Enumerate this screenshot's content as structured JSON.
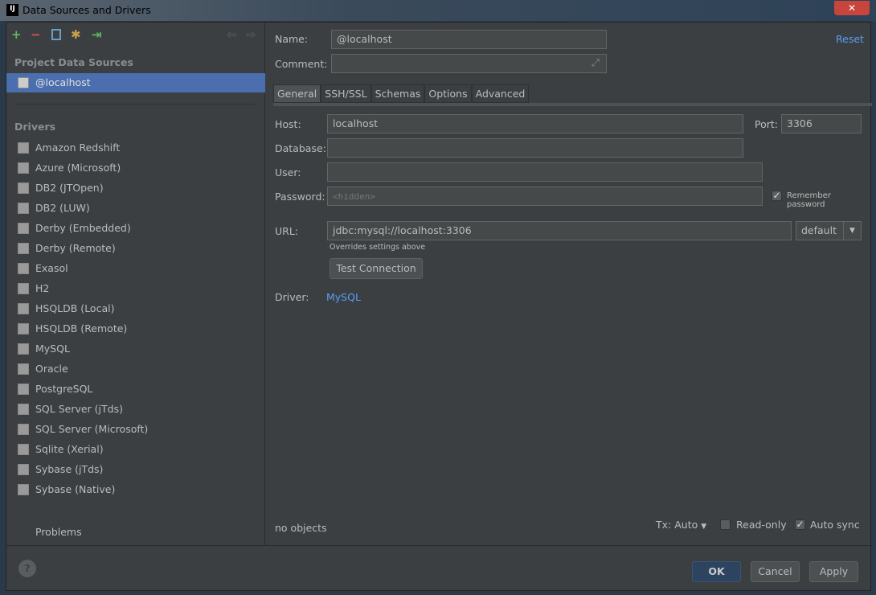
{
  "window": {
    "title": "Data Sources and Drivers",
    "logo": "IJ",
    "close": "✕"
  },
  "toolbar": {
    "add": "+",
    "remove": "−",
    "copy": "copy-icon",
    "settings": "wrench-icon",
    "import": "import-icon",
    "back": "⇦",
    "forward": "⇨"
  },
  "sidebar": {
    "project_header": "Project Data Sources",
    "selected": "@localhost",
    "drivers_header": "Drivers",
    "drivers": [
      "Amazon Redshift",
      "Azure (Microsoft)",
      "DB2 (JTOpen)",
      "DB2 (LUW)",
      "Derby (Embedded)",
      "Derby (Remote)",
      "Exasol",
      "H2",
      "HSQLDB (Local)",
      "HSQLDB (Remote)",
      "MySQL",
      "Oracle",
      "PostgreSQL",
      "SQL Server (jTds)",
      "SQL Server (Microsoft)",
      "Sqlite (Xerial)",
      "Sybase (jTds)",
      "Sybase (Native)"
    ],
    "problems": "Problems"
  },
  "form": {
    "name_label": "Name:",
    "name_value": "@localhost",
    "comment_label": "Comment:",
    "comment_value": "",
    "reset": "Reset",
    "tabs": [
      "General",
      "SSH/SSL",
      "Schemas",
      "Options",
      "Advanced"
    ],
    "host_label": "Host:",
    "host_value": "localhost",
    "port_label": "Port:",
    "port_value": "3306",
    "database_label": "Database:",
    "database_value": "",
    "user_label": "User:",
    "user_value": "",
    "password_label": "Password:",
    "password_placeholder": "<hidden>",
    "remember_password": "Remember password",
    "remember_checked": true,
    "url_label": "URL:",
    "url_value": "jdbc:mysql://localhost:3306",
    "url_mode": "default",
    "url_hint": "Overrides settings above",
    "test_connection": "Test Connection",
    "driver_label": "Driver:",
    "driver_value": "MySQL"
  },
  "status": {
    "objects": "no objects",
    "tx": "Tx: Auto",
    "read_only": "Read-only",
    "read_only_checked": false,
    "auto_sync": "Auto sync",
    "auto_sync_checked": true
  },
  "footer": {
    "help": "?",
    "ok": "OK",
    "cancel": "Cancel",
    "apply": "Apply"
  }
}
